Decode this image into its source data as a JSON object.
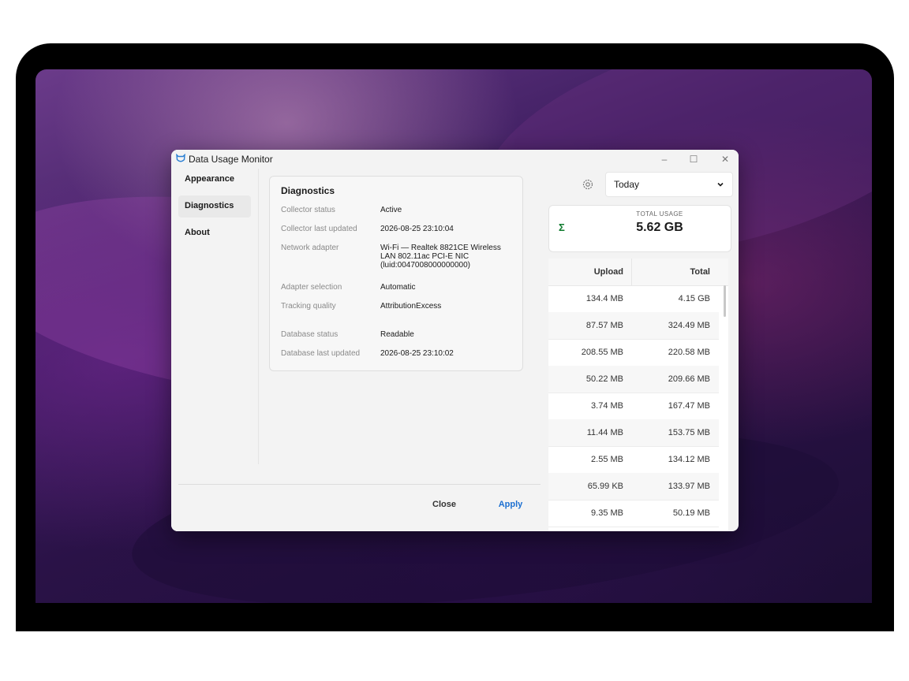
{
  "window": {
    "title": "Data Usage Monitor",
    "controls": {
      "minimize": "–",
      "maximize": "☐",
      "close": "✕"
    }
  },
  "toolbar": {
    "range_value": "Today",
    "gear_icon": "gear-icon",
    "chevron_icon": "chevron-down-icon"
  },
  "total": {
    "label": "TOTAL USAGE",
    "symbol": "Σ",
    "value": "5.62 GB"
  },
  "table": {
    "headers": {
      "upload": "Upload",
      "total": "Total"
    },
    "rows": [
      {
        "upload": "134.4 MB",
        "total": "4.15 GB"
      },
      {
        "upload": "87.57 MB",
        "total": "324.49 MB"
      },
      {
        "upload": "208.55 MB",
        "total": "220.58 MB"
      },
      {
        "upload": "50.22 MB",
        "total": "209.66 MB"
      },
      {
        "upload": "3.74 MB",
        "total": "167.47 MB"
      },
      {
        "upload": "11.44 MB",
        "total": "153.75 MB"
      },
      {
        "upload": "2.55 MB",
        "total": "134.12 MB"
      },
      {
        "upload": "65.99 KB",
        "total": "133.97 MB"
      },
      {
        "upload": "9.35 MB",
        "total": "50.19 MB"
      }
    ]
  },
  "settings": {
    "nav": [
      {
        "label": "Appearance",
        "selected": false
      },
      {
        "label": "Diagnostics",
        "selected": true
      },
      {
        "label": "About",
        "selected": false
      }
    ],
    "diagnostics": {
      "title": "Diagnostics",
      "fields": [
        {
          "key": "Collector status",
          "value": "Active"
        },
        {
          "key": "Collector last updated",
          "value": "2026-08-25 23:10:04"
        },
        {
          "key": "Network adapter",
          "value": "Wi-Fi — Realtek 8821CE Wireless LAN 802.11ac PCI-E NIC (luid:0047008000000000)"
        },
        {
          "key": "Adapter selection",
          "value": "Automatic"
        },
        {
          "key": "Tracking quality",
          "value": "AttributionExcess"
        },
        {
          "key": "Database status",
          "value": "Readable"
        },
        {
          "key": "Database last updated",
          "value": "2026-08-25 23:10:02"
        }
      ]
    },
    "buttons": {
      "close": "Close",
      "apply": "Apply"
    }
  }
}
